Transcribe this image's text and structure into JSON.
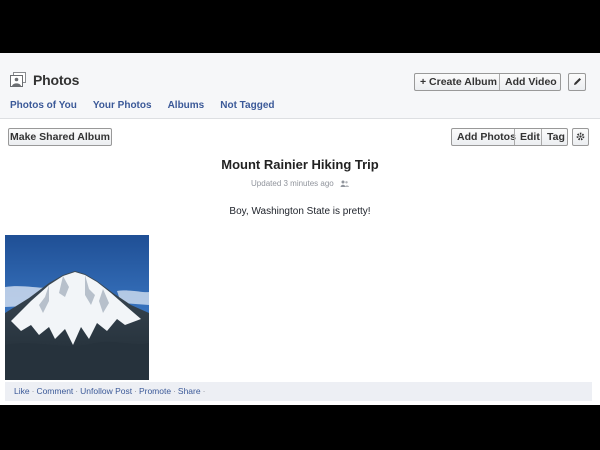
{
  "header": {
    "title": "Photos",
    "create_album": "+ Create Album",
    "add_video": "Add Video",
    "edit_icon": "pencil-icon"
  },
  "tabs": [
    {
      "label": "Photos of You"
    },
    {
      "label": "Your Photos"
    },
    {
      "label": "Albums"
    },
    {
      "label": "Not Tagged"
    }
  ],
  "toolbar": {
    "make_shared_album": "Make Shared Album",
    "add_photos": "Add Photos",
    "edit": "Edit",
    "tag": "Tag",
    "settings_icon": "gear-icon"
  },
  "album": {
    "title": "Mount Rainier Hiking Trip",
    "updated": "Updated 3 minutes ago",
    "description": "Boy, Washington State is pretty!"
  },
  "actions": {
    "like": "Like",
    "comment": "Comment",
    "unfollow": "Unfollow Post",
    "promote": "Promote",
    "share": "Share",
    "separator": "·"
  },
  "colors": {
    "link": "#3b5998",
    "header_bg": "#f6f7f9",
    "action_bar_bg": "#edeff4"
  }
}
